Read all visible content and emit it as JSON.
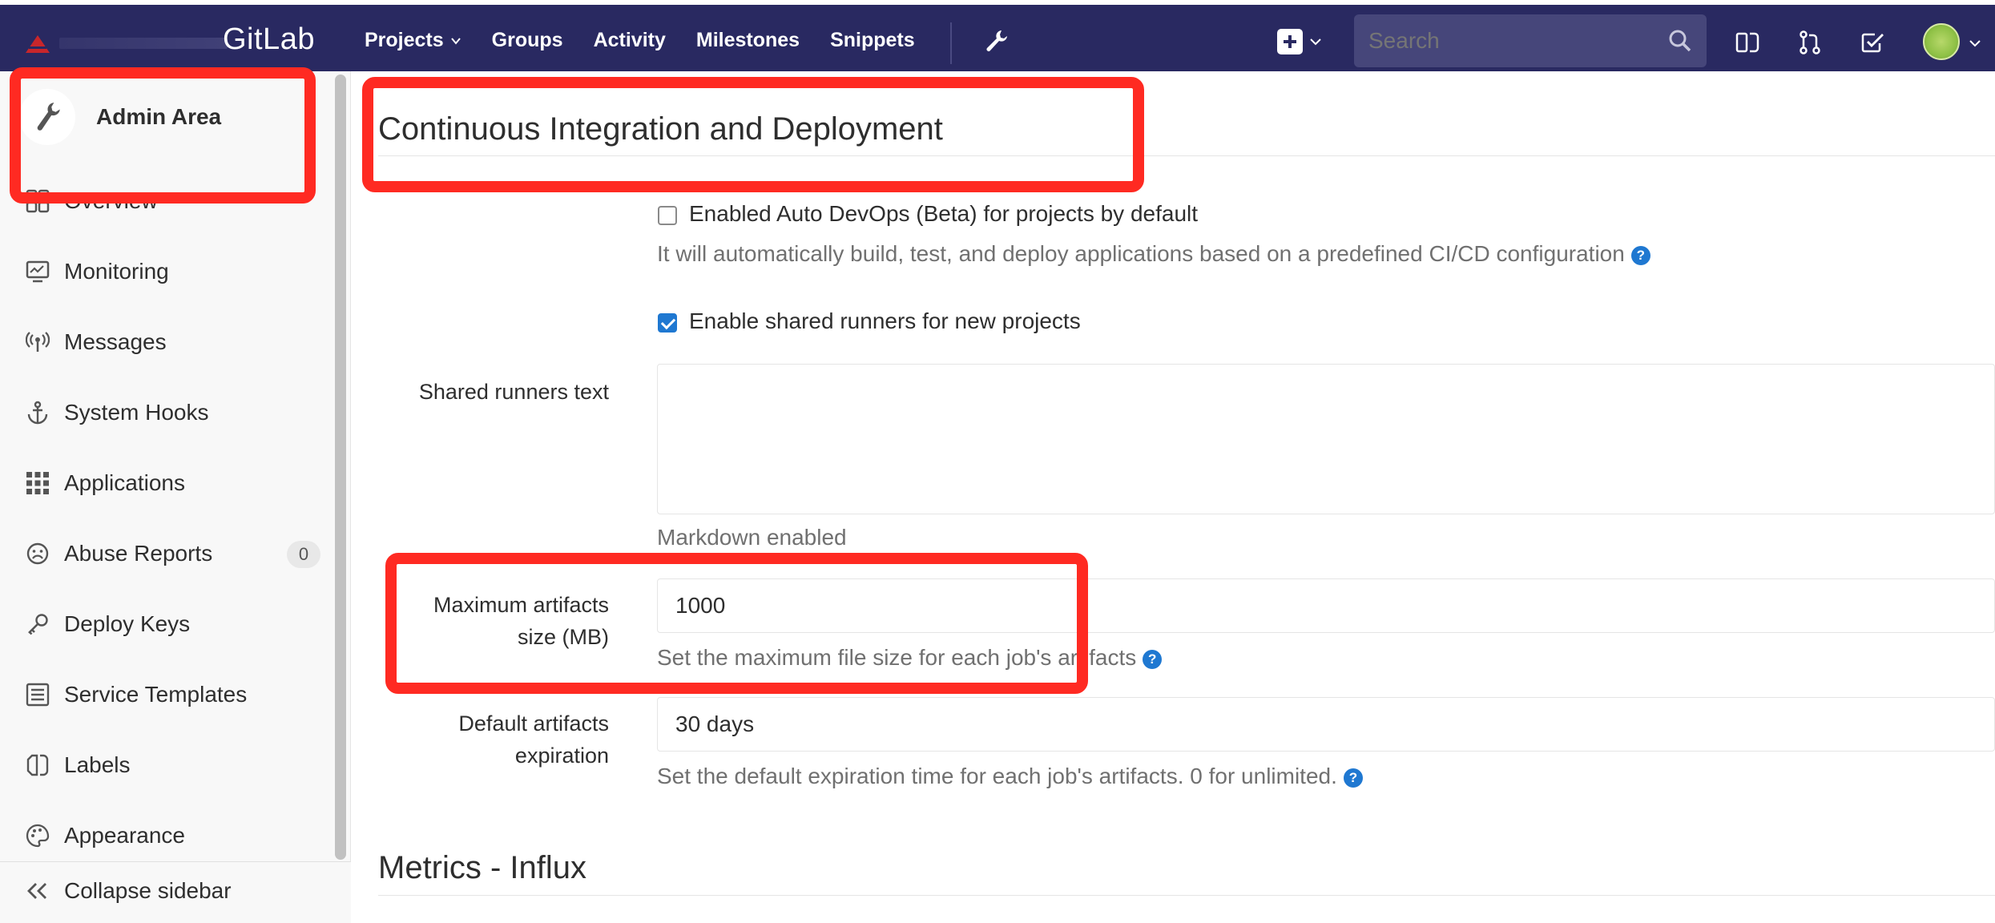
{
  "header": {
    "brand": "GitLab",
    "nav": [
      "Projects",
      "Groups",
      "Activity",
      "Milestones",
      "Snippets"
    ],
    "search_placeholder": "Search"
  },
  "sidebar": {
    "title": "Admin Area",
    "items": [
      {
        "label": "Overview",
        "icon": "overview-icon"
      },
      {
        "label": "Monitoring",
        "icon": "monitoring-icon"
      },
      {
        "label": "Messages",
        "icon": "messages-icon"
      },
      {
        "label": "System Hooks",
        "icon": "anchor-icon"
      },
      {
        "label": "Applications",
        "icon": "applications-icon"
      },
      {
        "label": "Abuse Reports",
        "icon": "abuse-icon",
        "badge": "0"
      },
      {
        "label": "Deploy Keys",
        "icon": "key-icon"
      },
      {
        "label": "Service Templates",
        "icon": "service-icon"
      },
      {
        "label": "Labels",
        "icon": "labels-icon"
      },
      {
        "label": "Appearance",
        "icon": "palette-icon"
      }
    ],
    "collapse_label": "Collapse sidebar"
  },
  "main": {
    "section_title": "Continuous Integration and Deployment",
    "auto_devops": {
      "label": "Enabled Auto DevOps (Beta) for projects by default",
      "checked": false,
      "help": "It will automatically build, test, and deploy applications based on a predefined CI/CD configuration"
    },
    "shared_runners": {
      "label": "Enable shared runners for new projects",
      "checked": true
    },
    "shared_runners_text": {
      "label": "Shared runners text",
      "value": "",
      "help": "Markdown enabled"
    },
    "max_artifacts": {
      "label_line1": "Maximum artifacts",
      "label_line2": "size (MB)",
      "value": "1000",
      "help": "Set the maximum file size for each job's artifacts"
    },
    "default_expiration": {
      "label_line1": "Default artifacts",
      "label_line2": "expiration",
      "value": "30 days",
      "help": "Set the default expiration time for each job's artifacts. 0 for unlimited."
    },
    "next_section_title": "Metrics - Influx"
  },
  "colors": {
    "topbar": "#292961",
    "accent": "#1f78d1",
    "annotation": "#ff2a22"
  }
}
